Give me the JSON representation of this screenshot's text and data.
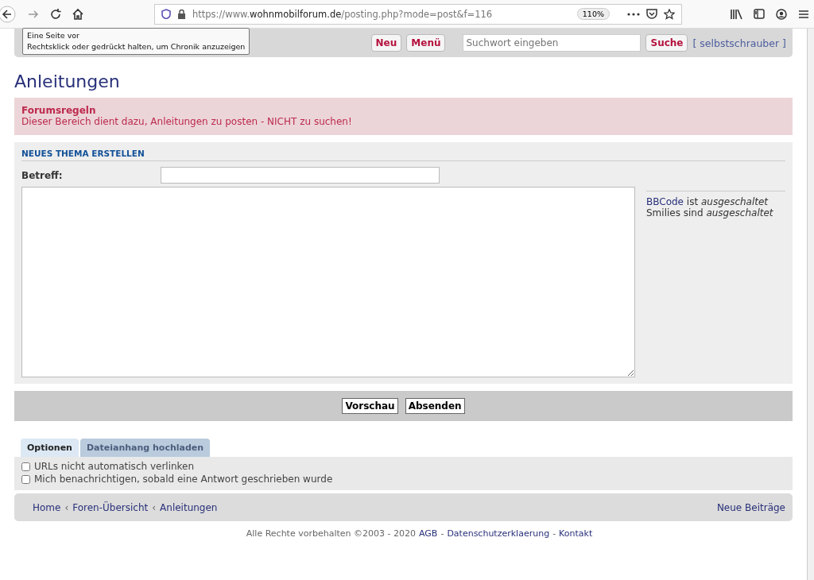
{
  "browser": {
    "url_prefix": "https://www.",
    "url_domain": "wohnmobilforum.de",
    "url_path": "/posting.php?mode=post&f=116",
    "zoom": "110%",
    "tooltip": [
      "Eine Seite vor",
      "Rechtsklick oder gedrückt halten, um Chronik anzuzeigen"
    ]
  },
  "header": {
    "buttons": [
      "Neu",
      "Menü"
    ],
    "search": {
      "placeholder": "Suchwort eingeben"
    },
    "search_button": "Suche",
    "user_link": "[ selbstschrauber ]"
  },
  "page_title": "Anleitungen",
  "rules": {
    "title": "Forumsregeln",
    "text": "Dieser Bereich dient dazu, Anleitungen zu posten - NICHT zu suchen!"
  },
  "form": {
    "heading": "NEUES THEMA ERSTELLEN",
    "subject_label": "Betreff:",
    "info": [
      {
        "link": "BBCode",
        "text": "ist *ausgeschaltet*"
      },
      {
        "text": "Smilies sind *ausgeschaltet*"
      }
    ],
    "buttons": [
      "Vorschau",
      "Absenden"
    ]
  },
  "tabs": [
    {
      "label": "Optionen",
      "selected": true
    },
    {
      "label": "Dateianhang hochladen",
      "selected": false
    }
  ],
  "options": [
    {
      "label": "URLs nicht automatisch verlinken",
      "checked": false
    },
    {
      "label": "Mich benachrichtigen, sobald eine Antwort geschrieben wurde",
      "checked": false
    }
  ],
  "breadcrumb": [
    {
      "kind": "link",
      "text": "Home"
    },
    {
      "kind": "separator",
      "text": "‹"
    },
    {
      "kind": "link",
      "text": "Foren-Übersicht"
    },
    {
      "kind": "separator",
      "text": "‹"
    },
    {
      "kind": "link",
      "text": "Anleitungen"
    }
  ],
  "new_posts": "Neue Beiträge",
  "footer": [
    {
      "kind": "text",
      "text": "Alle Rechte vorbehalten ©2003 - 2020"
    },
    {
      "kind": "link",
      "text": "AGB"
    },
    {
      "kind": "text",
      "text": "-"
    },
    {
      "kind": "link",
      "text": "Datenschutzerklaerung"
    },
    {
      "kind": "text",
      "text": "-"
    },
    {
      "kind": "link",
      "text": "Kontakt"
    }
  ]
}
